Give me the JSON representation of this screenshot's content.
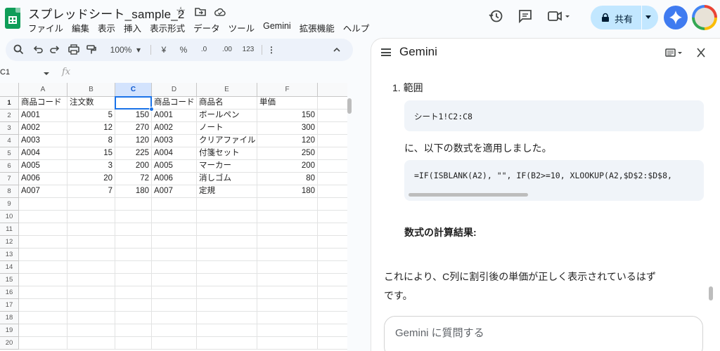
{
  "app": {
    "doc_title": "スプレッドシート_sample_2",
    "menu": [
      "ファイル",
      "編集",
      "表示",
      "挿入",
      "表示形式",
      "データ",
      "ツール",
      "Gemini",
      "拡張機能",
      "ヘルプ"
    ],
    "share_label": "共有"
  },
  "toolbar": {
    "zoom": "100%",
    "currency": "¥",
    "percent": "%",
    "decimal_decrease": ".0",
    "decimal_increase": ".00",
    "number_format": "123"
  },
  "formula_bar": {
    "name_box": "C1",
    "fx_label": "fx"
  },
  "sheet": {
    "columns": [
      "A",
      "B",
      "C",
      "D",
      "E",
      "F"
    ],
    "selected_column": "C",
    "rows": [
      [
        "商品コード",
        "注文数",
        "",
        "商品コード",
        "商品名",
        "単価"
      ],
      [
        "A001",
        "5",
        "150",
        "A001",
        "ボールペン",
        "150"
      ],
      [
        "A002",
        "12",
        "270",
        "A002",
        "ノート",
        "300"
      ],
      [
        "A003",
        "8",
        "120",
        "A003",
        "クリアファイル",
        "120"
      ],
      [
        "A004",
        "15",
        "225",
        "A004",
        "付箋セット",
        "250"
      ],
      [
        "A005",
        "3",
        "200",
        "A005",
        "マーカー",
        "200"
      ],
      [
        "A006",
        "20",
        "72",
        "A006",
        "消しゴム",
        "80"
      ],
      [
        "A007",
        "7",
        "180",
        "A007",
        "定規",
        "180"
      ]
    ],
    "row_numbers": [
      "1",
      "2",
      "3",
      "4",
      "5",
      "6",
      "7",
      "8",
      "9",
      "10",
      "11",
      "12",
      "13",
      "14",
      "15",
      "16",
      "17",
      "18",
      "19",
      "20"
    ]
  },
  "gemini": {
    "title": "Gemini",
    "step_label": "1. 範囲",
    "range_code": "シート1!C2:C8",
    "applied_text": "に、以下の数式を適用しました。",
    "formula_code": "=IF(ISBLANK(A2), \"\", IF(B2>=10, XLOOKUP(A2,$D$2:$D$8,",
    "result_heading": "数式の計算結果:",
    "conclusion_line1": "これにより、C列に割引後の単価が正しく表示されているはず",
    "conclusion_line2": "です。",
    "prompt_placeholder": "Gemini に質問する"
  }
}
